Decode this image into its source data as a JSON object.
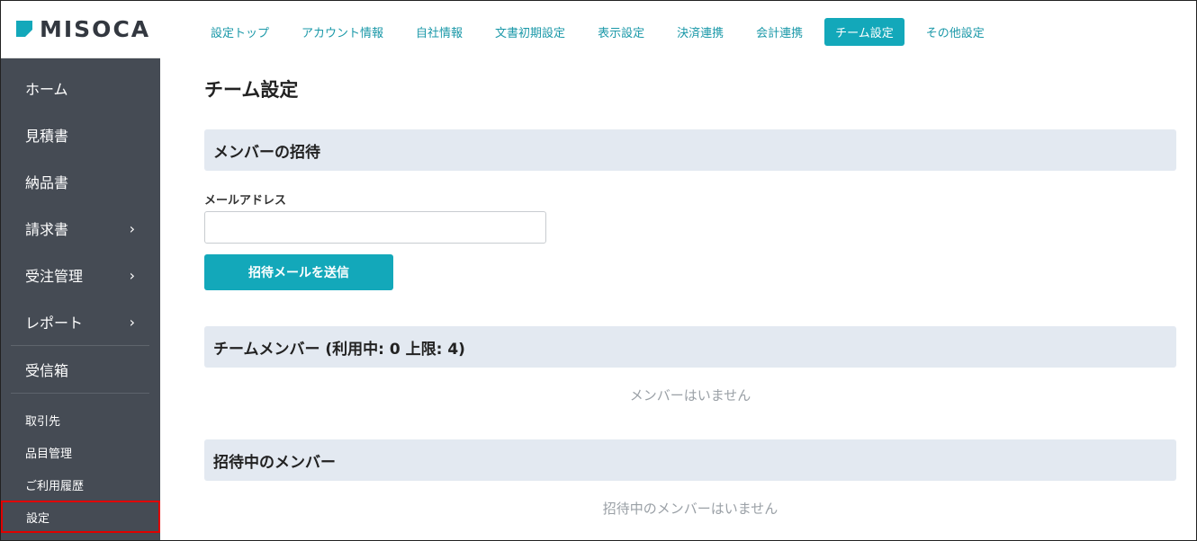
{
  "brand": {
    "name": "MISOCA"
  },
  "sidebar": {
    "main_items": [
      {
        "label": "ホーム",
        "chevron": false
      },
      {
        "label": "見積書",
        "chevron": false
      },
      {
        "label": "納品書",
        "chevron": false
      },
      {
        "label": "請求書",
        "chevron": true
      },
      {
        "label": "受注管理",
        "chevron": true
      },
      {
        "label": "レポート",
        "chevron": true
      },
      {
        "label": "受信箱",
        "chevron": false
      }
    ],
    "sub_items": [
      {
        "label": "取引先"
      },
      {
        "label": "品目管理"
      },
      {
        "label": "ご利用履歴"
      },
      {
        "label": "設定"
      }
    ]
  },
  "tabs": [
    "設定トップ",
    "アカウント情報",
    "自社情報",
    "文書初期設定",
    "表示設定",
    "決済連携",
    "会計連携",
    "チーム設定",
    "その他設定"
  ],
  "active_tab": "チーム設定",
  "page": {
    "title": "チーム設定",
    "invite_section": {
      "heading": "メンバーの招待",
      "email_label": "メールアドレス",
      "email_value": "",
      "send_button": "招待メールを送信"
    },
    "team_section": {
      "heading": "チームメンバー (利用中: 0 上限: 4)",
      "empty_text": "メンバーはいません"
    },
    "pending_section": {
      "heading": "招待中のメンバー",
      "empty_text": "招待中のメンバーはいません"
    }
  },
  "colors": {
    "accent": "#13a8ba",
    "sidebar_bg": "#454b54",
    "section_bg": "#e3e9f1",
    "highlight_border": "#e00000"
  }
}
